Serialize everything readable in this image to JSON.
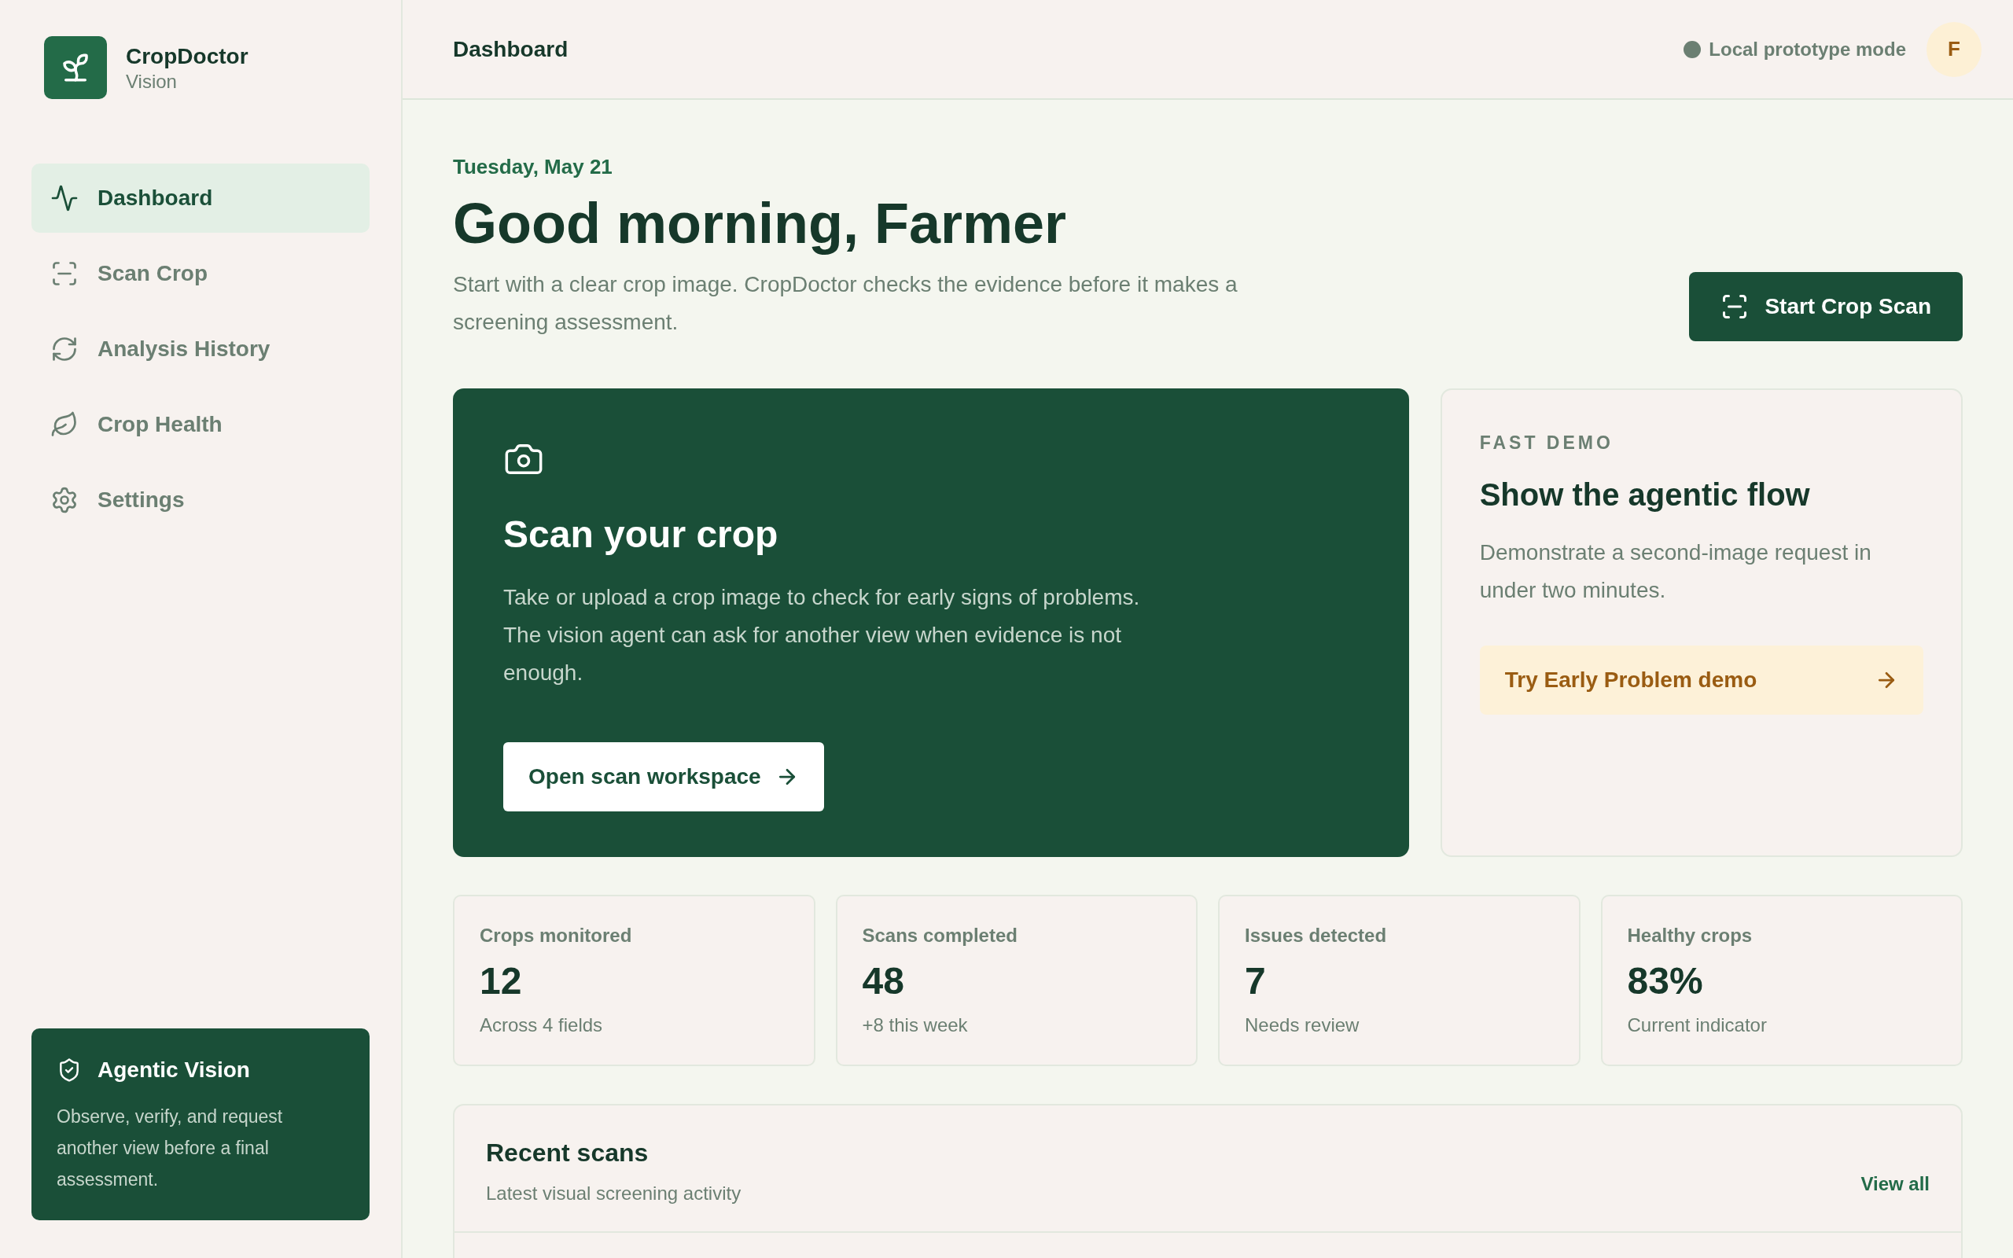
{
  "brand": {
    "name": "CropDoctor",
    "subtitle": "Vision"
  },
  "nav": [
    {
      "label": "Dashboard",
      "selected": true
    },
    {
      "label": "Scan Crop",
      "selected": false
    },
    {
      "label": "Analysis History",
      "selected": false
    },
    {
      "label": "Crop Health",
      "selected": false
    },
    {
      "label": "Settings",
      "selected": false
    }
  ],
  "sidebar_card": {
    "title": "Agentic Vision",
    "text": "Observe, verify, and request another view before a final assessment."
  },
  "header": {
    "title": "Dashboard",
    "status": "Local prototype mode",
    "avatar": "F"
  },
  "greeting": {
    "date": "Tuesday, May 21",
    "title": "Good morning, Farmer",
    "text": "Start with a clear crop image. CropDoctor checks the evidence before it makes a screening assessment.",
    "button": "Start Crop Scan"
  },
  "scan_card": {
    "title": "Scan your crop",
    "text": "Take or upload a crop image to check for early signs of problems. The vision agent can ask for another view when evidence is not enough.",
    "button": "Open scan workspace"
  },
  "demo_card": {
    "eyebrow": "FAST DEMO",
    "title": "Show the agentic flow",
    "text": "Demonstrate a second-image request in under two minutes.",
    "button": "Try Early Problem demo"
  },
  "stats": [
    {
      "label": "Crops monitored",
      "value": "12",
      "note": "Across 4 fields"
    },
    {
      "label": "Scans completed",
      "value": "48",
      "note": "+8 this week"
    },
    {
      "label": "Issues detected",
      "value": "7",
      "note": "Needs review"
    },
    {
      "label": "Healthy crops",
      "value": "83%",
      "note": "Current indicator"
    }
  ],
  "recent": {
    "title": "Recent scans",
    "subtitle": "Latest visual screening activity",
    "link": "View all"
  }
}
